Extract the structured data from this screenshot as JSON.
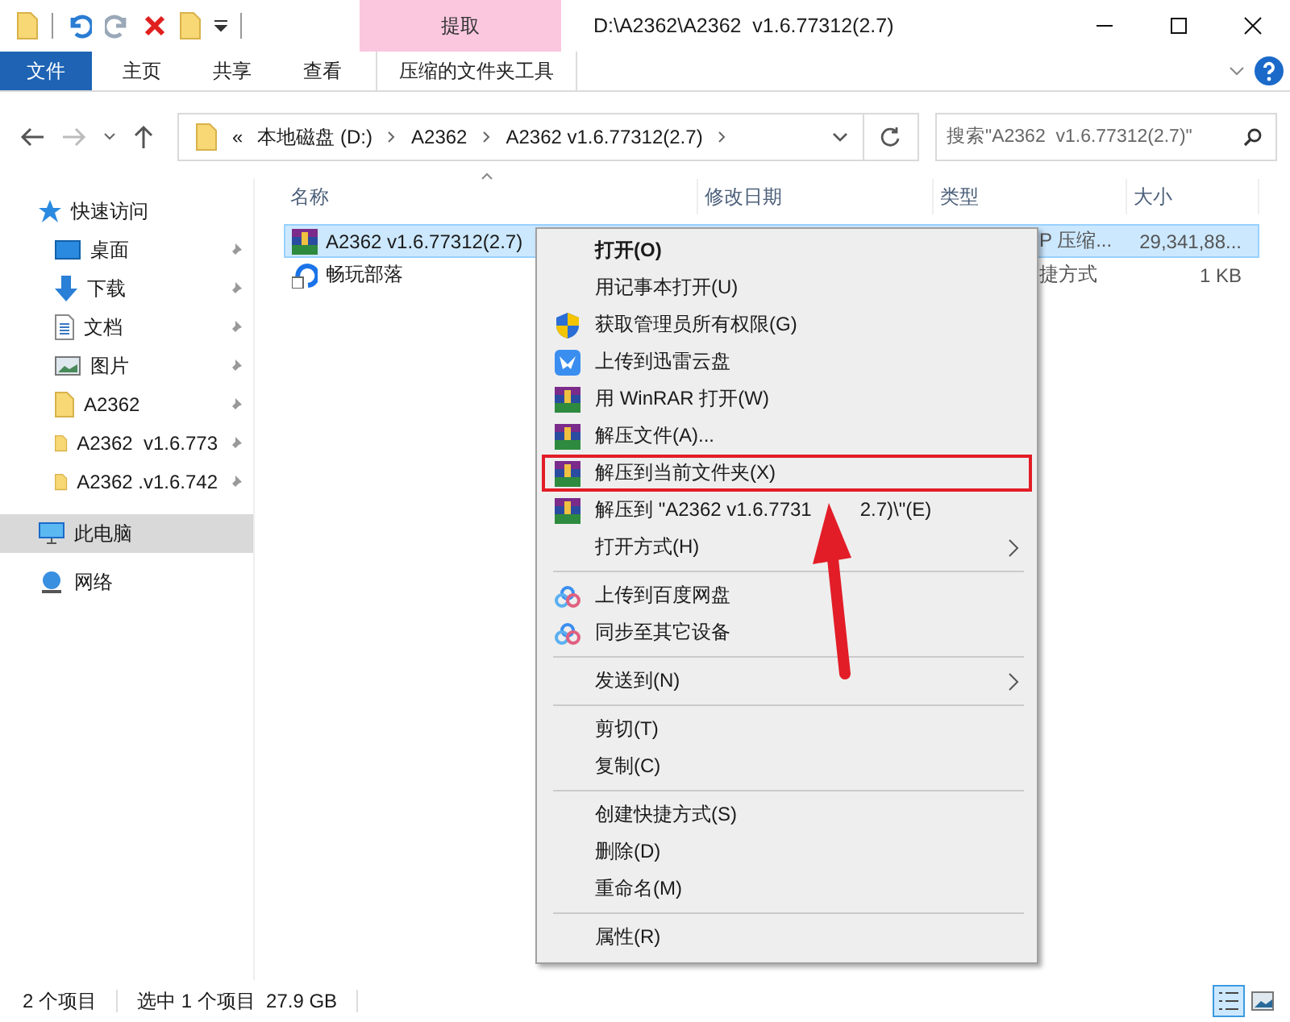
{
  "window": {
    "title": "D:\\A2362\\A2362  v1.6.77312(2.7)",
    "context_tab": "提取"
  },
  "ribbon": {
    "tabs": [
      {
        "label": "文件",
        "selected": true
      },
      {
        "label": "主页",
        "selected": false
      },
      {
        "label": "共享",
        "selected": false
      },
      {
        "label": "查看",
        "selected": false
      },
      {
        "label": "压缩的文件夹工具",
        "selected": false
      }
    ]
  },
  "address": {
    "overflow": "«",
    "crumbs": [
      "本地磁盘 (D:)",
      "A2362",
      "A2362  v1.6.77312(2.7)"
    ]
  },
  "search": {
    "placeholder": "搜索\"A2362  v1.6.77312(2.7)\""
  },
  "sidebar": {
    "items": [
      {
        "label": "快速访问",
        "kind": "star",
        "pinned": false,
        "selected": false
      },
      {
        "label": "桌面",
        "kind": "desktop",
        "pinned": true,
        "selected": false
      },
      {
        "label": "下载",
        "kind": "download",
        "pinned": true,
        "selected": false
      },
      {
        "label": "文档",
        "kind": "document",
        "pinned": true,
        "selected": false
      },
      {
        "label": "图片",
        "kind": "image",
        "pinned": true,
        "selected": false
      },
      {
        "label": "A2362",
        "kind": "folder",
        "pinned": true,
        "selected": false
      },
      {
        "label": "A2362  v1.6.773",
        "kind": "folder",
        "pinned": true,
        "selected": false
      },
      {
        "label": "A2362 .v1.6.742",
        "kind": "folder",
        "pinned": true,
        "selected": false
      },
      {
        "label": "此电脑",
        "kind": "pc",
        "pinned": false,
        "selected": true
      },
      {
        "label": "网络",
        "kind": "network",
        "pinned": false,
        "selected": false
      }
    ]
  },
  "table": {
    "columns": [
      "名称",
      "修改日期",
      "类型",
      "大小"
    ],
    "rows": [
      {
        "name": "A2362  v1.6.77312(2.7)",
        "kind": "archive",
        "type": "P 压缩...",
        "size": "29,341,88...",
        "selected": true
      },
      {
        "name": "畅玩部落",
        "kind": "shortcut",
        "type": "捷方式",
        "size": "1 KB",
        "selected": false
      }
    ]
  },
  "context_menu": {
    "items": [
      {
        "kind": "item",
        "label": "打开(O)",
        "default": true,
        "submenu": false,
        "highlighted": false
      },
      {
        "kind": "item",
        "label": "用记事本打开(U)",
        "default": false,
        "submenu": false,
        "highlighted": false
      },
      {
        "kind": "shield",
        "label": "获取管理员所有权限(G)",
        "default": false,
        "submenu": false,
        "highlighted": false
      },
      {
        "kind": "bird",
        "label": "上传到迅雷云盘",
        "default": false,
        "submenu": false,
        "highlighted": false
      },
      {
        "kind": "archive",
        "label": "用 WinRAR 打开(W)",
        "default": false,
        "submenu": false,
        "highlighted": false
      },
      {
        "kind": "archive",
        "label": "解压文件(A)...",
        "default": false,
        "submenu": false,
        "highlighted": false
      },
      {
        "kind": "archive",
        "label": "解压到当前文件夹(X)",
        "default": false,
        "submenu": false,
        "highlighted": true
      },
      {
        "kind": "archive",
        "label": "解压到 \"A2362  v1.6.7731",
        "label_after": "2.7)\\\"(E)",
        "default": false,
        "submenu": false,
        "highlighted": false
      },
      {
        "kind": "item",
        "label": "打开方式(H)",
        "default": false,
        "submenu": true,
        "highlighted": false
      },
      {
        "kind": "separator"
      },
      {
        "kind": "cloud",
        "label": "上传到百度网盘",
        "default": false,
        "submenu": false,
        "highlighted": false
      },
      {
        "kind": "cloud",
        "label": "同步至其它设备",
        "default": false,
        "submenu": false,
        "highlighted": false
      },
      {
        "kind": "separator"
      },
      {
        "kind": "item",
        "label": "发送到(N)",
        "default": false,
        "submenu": true,
        "highlighted": false
      },
      {
        "kind": "separator"
      },
      {
        "kind": "item",
        "label": "剪切(T)",
        "default": false,
        "submenu": false,
        "highlighted": false
      },
      {
        "kind": "item",
        "label": "复制(C)",
        "default": false,
        "submenu": false,
        "highlighted": false
      },
      {
        "kind": "separator"
      },
      {
        "kind": "item",
        "label": "创建快捷方式(S)",
        "default": false,
        "submenu": false,
        "highlighted": false
      },
      {
        "kind": "item",
        "label": "删除(D)",
        "default": false,
        "submenu": false,
        "highlighted": false
      },
      {
        "kind": "item",
        "label": "重命名(M)",
        "default": false,
        "submenu": false,
        "highlighted": false
      },
      {
        "kind": "separator"
      },
      {
        "kind": "item",
        "label": "属性(R)",
        "default": false,
        "submenu": false,
        "highlighted": false
      }
    ]
  },
  "status_bar": {
    "items": [
      "2 个项目",
      "选中 1 个项目  27.9 GB"
    ]
  }
}
